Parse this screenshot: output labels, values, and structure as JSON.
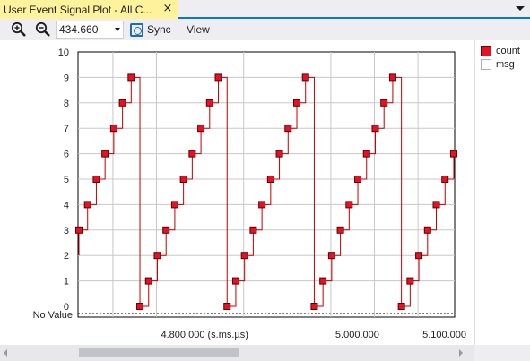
{
  "window": {
    "tab_title": "User Event Signal Plot - All C...",
    "close_glyph": "×"
  },
  "toolbar": {
    "zoom_value": "434.660",
    "sync_label": "Sync",
    "view_label": "View"
  },
  "legend": {
    "items": [
      {
        "label": "count",
        "color": "#e81123"
      },
      {
        "label": "msg",
        "color": "#ffffff"
      }
    ]
  },
  "colors": {
    "accent": "#007acc",
    "tab_active": "#fff29d",
    "series": "#c00000",
    "marker_fill": "#e81123"
  },
  "chart_data": {
    "type": "line",
    "step": true,
    "ylim": [
      0,
      10
    ],
    "yticks": [
      "0",
      "1",
      "2",
      "3",
      "4",
      "5",
      "6",
      "7",
      "8",
      "9",
      "10"
    ],
    "no_value_label": "No Value",
    "xlim_index": [
      0,
      43.5
    ],
    "x_tick_labels": [
      {
        "label": "4.800.000 (s.ms.µs)",
        "at_index": 8.9
      },
      {
        "label": "5.000.000",
        "at_index": 28.9
      },
      {
        "label": "5.100.000",
        "at_index": 38.9
      }
    ],
    "series": [
      {
        "name": "count",
        "values": [
          3,
          4,
          5,
          6,
          7,
          8,
          9,
          0,
          1,
          2,
          3,
          4,
          5,
          6,
          7,
          8,
          9,
          0,
          1,
          2,
          3,
          4,
          5,
          6,
          7,
          8,
          9,
          0,
          1,
          2,
          3,
          4,
          5,
          6,
          7,
          8,
          9,
          0,
          1,
          2,
          3,
          4,
          5,
          6
        ]
      }
    ],
    "grid": true
  }
}
